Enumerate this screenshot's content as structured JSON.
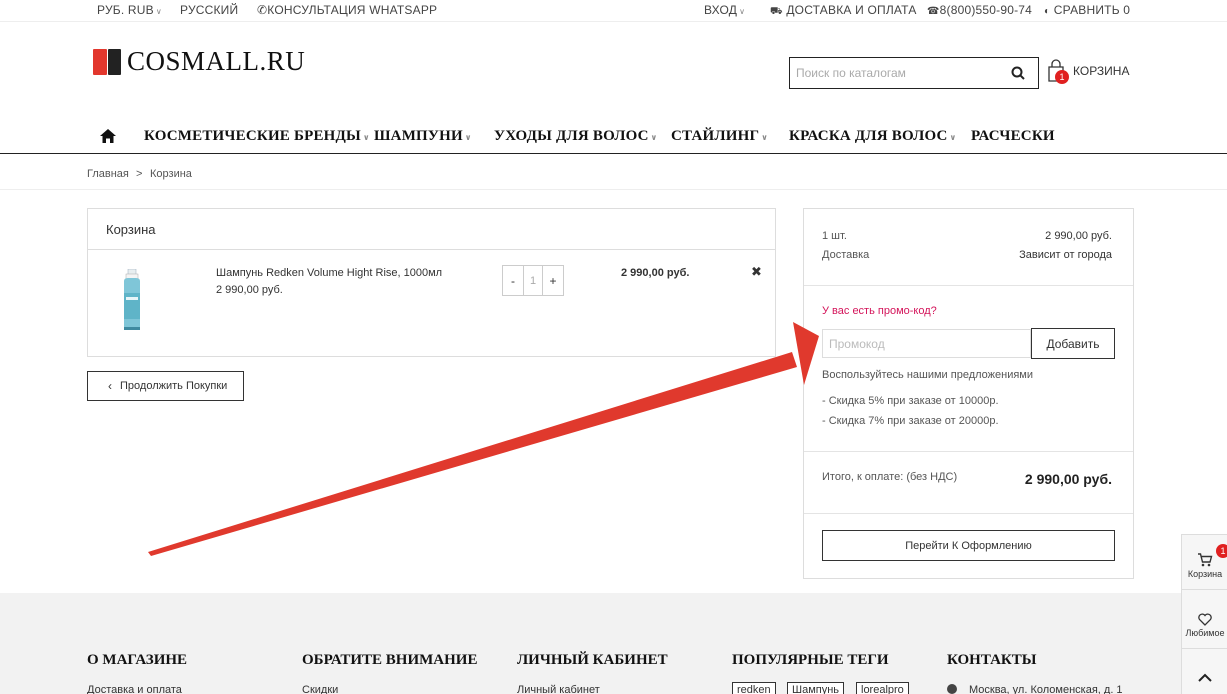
{
  "topbar": {
    "currency": "РУБ. RUB",
    "language": "РУССКИЙ",
    "whatsapp": "КОНСУЛЬТАЦИЯ WHATSAPP",
    "login": "ВХОД",
    "delivery": "ДОСТАВКА И ОПЛАТА",
    "phone": "8(800)550-90-74",
    "compare": "СРАВНИТЬ 0"
  },
  "header": {
    "logo_text": "COSMALL.RU",
    "search_placeholder": "Поиск по каталогам",
    "cart_label": "КОРЗИНА",
    "cart_count": "1"
  },
  "nav": {
    "items": [
      {
        "label": "КОСМЕТИЧЕСКИЕ БРЕНДЫ",
        "dropdown": true
      },
      {
        "label": "ШАМПУНИ",
        "dropdown": true
      },
      {
        "label": "УХОДЫ ДЛЯ ВОЛОС",
        "dropdown": true
      },
      {
        "label": "СТАЙЛИНГ",
        "dropdown": true
      },
      {
        "label": "КРАСКА ДЛЯ ВОЛОС",
        "dropdown": true
      },
      {
        "label": "РАСЧЕСКИ",
        "dropdown": false
      }
    ]
  },
  "breadcrumb": {
    "home": "Главная",
    "separator": ">",
    "current": "Корзина"
  },
  "cart": {
    "title": "Корзина",
    "item": {
      "name": "Шампунь Redken Volume Hight Rise, 1000мл",
      "unit_price": "2 990,00 руб.",
      "quantity": "1",
      "minus": "-",
      "plus": "+",
      "total": "2 990,00 руб."
    },
    "continue_label": "Продолжить Покупки"
  },
  "summary": {
    "qty_label": "1 шт.",
    "qty_value": "2 990,00 руб.",
    "delivery_label": "Доставка",
    "delivery_value": "Зависит от города",
    "promo_question": "У вас есть промо-код?",
    "promo_placeholder": "Промокод",
    "promo_button": "Добавить",
    "offers_title": "Воспользуйтесь нашими предложениями",
    "offers": [
      "- Скидка 5% при заказе от 10000р.",
      "- Скидка 7% при заказе от 20000р."
    ],
    "total_label": "Итого, к оплате: (без НДС)",
    "total_value": "2 990,00 руб.",
    "checkout_label": "Перейти К Оформлению"
  },
  "footer": {
    "columns": [
      {
        "title": "О МАГАЗИНЕ",
        "first_link": "Доставка и оплата"
      },
      {
        "title": "ОБРАТИТЕ ВНИМАНИЕ",
        "first_link": "Скидки"
      },
      {
        "title": "ЛИЧНЫЙ КАБИНЕТ",
        "first_link": "Личный кабинет"
      },
      {
        "title": "ПОПУЛЯРНЫЕ ТЕГИ",
        "first_link": ""
      },
      {
        "title": "КОНТАКТЫ",
        "first_link": "Москва, ул. Коломенская, д. 1"
      }
    ],
    "tags": [
      "redken",
      "Шампунь",
      "lorealpro"
    ]
  },
  "side_widget": {
    "cart_label": "Корзина",
    "cart_count": "1",
    "favorites_label": "Любимое"
  },
  "colors": {
    "accent_pink": "#d4145a",
    "badge_red": "#e02020",
    "annotation_arrow": "#e0392d",
    "logo_red": "#e2372d"
  }
}
